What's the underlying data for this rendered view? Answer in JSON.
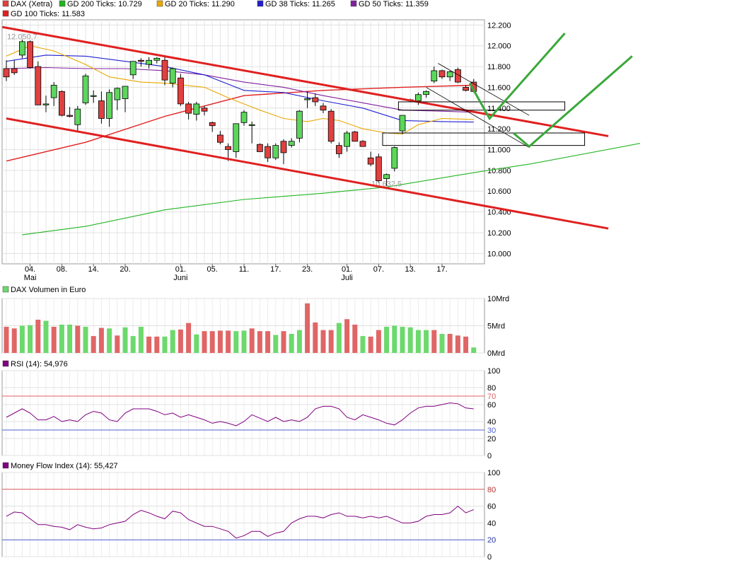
{
  "chart_data": [
    {
      "type": "candlestick",
      "title": "DAX (Xetra)",
      "legend": [
        {
          "label": "DAX (Xetra)",
          "color": "#e04040"
        },
        {
          "label": "GD 200 Ticks: 10.729",
          "color": "#22b422"
        },
        {
          "label": "GD 20 Ticks: 11.290",
          "color": "#e8a800"
        },
        {
          "label": "GD 38 Ticks: 11.265",
          "color": "#2020d0"
        },
        {
          "label": "GD 50 Ticks: 11.359",
          "color": "#8020a0"
        },
        {
          "label": "GD 100 Ticks: 11.583",
          "color": "#e02020"
        }
      ],
      "ylim": [
        9900,
        12250
      ],
      "yticks": [
        10000,
        10200,
        10400,
        10600,
        10800,
        11000,
        11200,
        11400,
        11600,
        11800,
        12000,
        12200
      ],
      "ytick_labels": [
        "10.000",
        "10.200",
        "10.400",
        "10.600",
        "10.800",
        "11.000",
        "11.200",
        "11.400",
        "11.600",
        "11.800",
        "12.000",
        "12.200"
      ],
      "xtick_labels": [
        {
          "i": 3,
          "day": "04.",
          "month": "Mai"
        },
        {
          "i": 7,
          "day": "08.",
          "month": ""
        },
        {
          "i": 11,
          "day": "14.",
          "month": ""
        },
        {
          "i": 15,
          "day": "20.",
          "month": ""
        },
        {
          "i": 22,
          "day": "01.",
          "month": "Juni"
        },
        {
          "i": 26,
          "day": "05.",
          "month": ""
        },
        {
          "i": 30,
          "day": "11.",
          "month": ""
        },
        {
          "i": 34,
          "day": "17.",
          "month": ""
        },
        {
          "i": 38,
          "day": "23.",
          "month": ""
        },
        {
          "i": 43,
          "day": "01.",
          "month": "Juli"
        },
        {
          "i": 47,
          "day": "07.",
          "month": ""
        },
        {
          "i": 51,
          "day": "13.",
          "month": ""
        },
        {
          "i": 55,
          "day": "17.",
          "month": ""
        }
      ],
      "annotations": [
        {
          "text": "12.050,7",
          "i": 2,
          "value": 12050
        },
        {
          "text": "10.632,5",
          "i": 48,
          "value": 10632
        }
      ],
      "candles": [
        [
          11780,
          11860,
          11660,
          11700
        ],
        [
          11780,
          11860,
          11720,
          11740
        ],
        [
          11910,
          12060,
          11880,
          12040
        ],
        [
          12040,
          12050,
          11780,
          11790
        ],
        [
          11800,
          11850,
          11430,
          11430
        ],
        [
          11430,
          11520,
          11360,
          11440
        ],
        [
          11500,
          11650,
          11420,
          11620
        ],
        [
          11560,
          11570,
          11320,
          11330
        ],
        [
          11330,
          11410,
          11310,
          11320
        ],
        [
          11240,
          11420,
          11180,
          11390
        ],
        [
          11450,
          11730,
          11430,
          11710
        ],
        [
          11520,
          11570,
          11450,
          11520
        ],
        [
          11470,
          11560,
          11250,
          11300
        ],
        [
          11300,
          11580,
          11220,
          11550
        ],
        [
          11480,
          11600,
          11380,
          11590
        ],
        [
          11490,
          11600,
          11360,
          11610
        ],
        [
          11720,
          11850,
          11680,
          11850
        ],
        [
          11860,
          11880,
          11800,
          11850
        ],
        [
          11820,
          11890,
          11780,
          11860
        ],
        [
          11860,
          11890,
          11830,
          11880
        ],
        [
          11860,
          11890,
          11620,
          11670
        ],
        [
          11640,
          11790,
          11600,
          11780
        ],
        [
          11690,
          11730,
          11420,
          11440
        ],
        [
          11440,
          11460,
          11290,
          11350
        ],
        [
          11340,
          11460,
          11280,
          11440
        ],
        [
          11400,
          11420,
          11330,
          11370
        ],
        [
          11260,
          11270,
          11170,
          11230
        ],
        [
          11140,
          11180,
          11050,
          11070
        ],
        [
          11030,
          11060,
          10890,
          11000
        ],
        [
          10980,
          11230,
          10920,
          11250
        ],
        [
          11260,
          11380,
          11230,
          11360
        ],
        [
          11240,
          11270,
          11060,
          11240
        ],
        [
          11050,
          11060,
          10980,
          10980
        ],
        [
          11030,
          11060,
          10880,
          10920
        ],
        [
          10920,
          11060,
          10900,
          11040
        ],
        [
          11080,
          11100,
          10860,
          10970
        ],
        [
          11040,
          11110,
          11020,
          11080
        ],
        [
          11110,
          11380,
          11070,
          11370
        ],
        [
          11480,
          11560,
          11400,
          11490
        ],
        [
          11500,
          11540,
          11420,
          11460
        ],
        [
          11420,
          11450,
          11350,
          11380
        ],
        [
          11370,
          11390,
          11060,
          11080
        ],
        [
          11040,
          11070,
          10920,
          10960
        ],
        [
          11030,
          11180,
          10980,
          11160
        ],
        [
          11170,
          11180,
          11080,
          11080
        ],
        [
          11080,
          11090,
          11030,
          11030
        ],
        [
          10920,
          10980,
          10840,
          10860
        ],
        [
          10930,
          10960,
          10680,
          10700
        ],
        [
          10720,
          10770,
          10650,
          10760
        ],
        [
          10820,
          11030,
          10790,
          11020
        ],
        [
          11180,
          11320,
          11150,
          11330
        ],
        [
          11480,
          11490,
          11460,
          11480
        ],
        [
          11470,
          11550,
          11430,
          11530
        ],
        [
          11530,
          11570,
          11500,
          11560
        ],
        [
          11660,
          11800,
          11640,
          11760
        ],
        [
          11760,
          11770,
          11680,
          11700
        ],
        [
          11700,
          11760,
          11660,
          11750
        ],
        [
          11770,
          11790,
          11640,
          11650
        ],
        [
          11600,
          11620,
          11560,
          11570
        ],
        [
          11650,
          11680,
          11550,
          11560
        ]
      ],
      "ma_series": [
        {
          "name": "GD 200 Ticks: 10.729",
          "color": "#22b422",
          "points": [
            [
              2,
              10180
            ],
            [
              10,
              10260
            ],
            [
              20,
              10420
            ],
            [
              30,
              10520
            ],
            [
              40,
              10580
            ],
            [
              48,
              10640
            ],
            [
              60,
              10790
            ],
            [
              66,
              10860
            ],
            [
              80,
              11060
            ]
          ]
        },
        {
          "name": "GD 100 Ticks: 11.583",
          "color": "#e02020",
          "points": [
            [
              0,
              10890
            ],
            [
              10,
              11070
            ],
            [
              20,
              11320
            ],
            [
              30,
              11520
            ],
            [
              40,
              11570
            ],
            [
              50,
              11600
            ],
            [
              59,
              11620
            ]
          ]
        },
        {
          "name": "GD 50 Ticks: 11.359",
          "color": "#8020a0",
          "points": [
            [
              0,
              11780
            ],
            [
              5,
              11790
            ],
            [
              10,
              11780
            ],
            [
              15,
              11780
            ],
            [
              20,
              11760
            ],
            [
              25,
              11720
            ],
            [
              30,
              11650
            ],
            [
              35,
              11600
            ],
            [
              40,
              11520
            ],
            [
              45,
              11450
            ],
            [
              50,
              11380
            ],
            [
              55,
              11370
            ],
            [
              59,
              11360
            ]
          ]
        },
        {
          "name": "GD 38 Ticks: 11.265",
          "color": "#2020d0",
          "points": [
            [
              0,
              11850
            ],
            [
              5,
              11910
            ],
            [
              10,
              11900
            ],
            [
              15,
              11850
            ],
            [
              20,
              11800
            ],
            [
              25,
              11720
            ],
            [
              30,
              11570
            ],
            [
              35,
              11550
            ],
            [
              40,
              11470
            ],
            [
              45,
              11400
            ],
            [
              50,
              11280
            ],
            [
              55,
              11270
            ],
            [
              59,
              11265
            ]
          ]
        },
        {
          "name": "GD 20 Ticks: 11.290",
          "color": "#e8a800",
          "points": [
            [
              0,
              11900
            ],
            [
              3,
              12000
            ],
            [
              6,
              11950
            ],
            [
              10,
              11820
            ],
            [
              13,
              11700
            ],
            [
              17,
              11650
            ],
            [
              20,
              11640
            ],
            [
              25,
              11600
            ],
            [
              28,
              11500
            ],
            [
              32,
              11380
            ],
            [
              35,
              11300
            ],
            [
              38,
              11270
            ],
            [
              40,
              11300
            ],
            [
              42,
              11280
            ],
            [
              45,
              11200
            ],
            [
              48,
              11160
            ],
            [
              50,
              11150
            ],
            [
              52,
              11240
            ],
            [
              55,
              11300
            ],
            [
              59,
              11290
            ]
          ]
        }
      ],
      "drawings": {
        "red_trendlines": [
          [
            [
              -0.5,
              12180
            ],
            [
              76,
              11130
            ]
          ],
          [
            [
              0,
              11300
            ],
            [
              76,
              10240
            ]
          ]
        ],
        "black_channel": [
          [
            [
              54.5,
              11830
            ],
            [
              66,
              11330
            ]
          ],
          [
            [
              53,
              11600
            ],
            [
              66,
              11020
            ]
          ]
        ],
        "rectangles": [
          {
            "x0": 49.5,
            "x1": 70.5,
            "y0": 11380,
            "y1": 11460
          },
          {
            "x0": 47.5,
            "x1": 73,
            "y0": 11040,
            "y1": 11160
          }
        ],
        "green_arrows": [
          [
            [
              58.5,
              11640
            ],
            [
              61,
              11300
            ],
            [
              70.5,
              12120
            ]
          ],
          [
            [
              64,
              11160
            ],
            [
              66,
              11030
            ],
            [
              79,
              11900
            ]
          ]
        ]
      }
    },
    {
      "type": "bar",
      "title": "DAX Volumen in Euro",
      "ylim": [
        0,
        10
      ],
      "yticks": [
        0,
        5,
        10
      ],
      "ytick_labels": [
        "0Mrd",
        "5Mrd",
        "10Mrd"
      ],
      "values": [
        4.8,
        4.5,
        5.0,
        5.1,
        6.1,
        5.9,
        4.8,
        5.2,
        5.2,
        5.0,
        4.8,
        3.1,
        4.6,
        4.5,
        3.2,
        4.7,
        3.1,
        4.8,
        3.0,
        3.0,
        3.0,
        4.2,
        4.3,
        5.5,
        3.4,
        4.0,
        4.0,
        4.1,
        4.1,
        4.0,
        4.1,
        4.5,
        4.0,
        4.0,
        3.3,
        4.0,
        3.5,
        4.2,
        9.1,
        5.6,
        4.2,
        4.2,
        5.5,
        6.2,
        5.2,
        3.1,
        3.0,
        4.2,
        4.8,
        5.0,
        4.8,
        4.7,
        4.2,
        4.2,
        4.2,
        3.5,
        3.5,
        3.2,
        3.0,
        1.0
      ],
      "colors": [
        "r",
        "r",
        "g",
        "g",
        "r",
        "g",
        "r",
        "g",
        "g",
        "r",
        "g",
        "r",
        "r",
        "g",
        "r",
        "g",
        "g",
        "g",
        "r",
        "r",
        "g",
        "g",
        "r",
        "r",
        "g",
        "r",
        "r",
        "r",
        "r",
        "g",
        "g",
        "r",
        "r",
        "r",
        "g",
        "r",
        "g",
        "g",
        "r",
        "r",
        "r",
        "r",
        "g",
        "r",
        "r",
        "g",
        "r",
        "r",
        "g",
        "g",
        "g",
        "g",
        "g",
        "g",
        "r",
        "g",
        "r",
        "r",
        "r",
        "g"
      ]
    },
    {
      "type": "line",
      "title": "RSI (14): 54,976",
      "ylim": [
        0,
        100
      ],
      "yticks": [
        0,
        20,
        40,
        60,
        80,
        100
      ],
      "ytick_labels": [
        "0",
        "20",
        "40",
        "60",
        "80",
        "100"
      ],
      "ref_lines": [
        {
          "value": 70,
          "label": "70",
          "color": "#e06060"
        },
        {
          "value": 30,
          "label": "30",
          "color": "#5060d0"
        }
      ],
      "color": "#800080",
      "values": [
        45,
        50,
        55,
        50,
        42,
        42,
        46,
        40,
        42,
        40,
        48,
        52,
        50,
        42,
        40,
        50,
        55,
        55,
        55,
        52,
        48,
        50,
        45,
        48,
        45,
        42,
        38,
        40,
        38,
        35,
        40,
        48,
        44,
        40,
        45,
        40,
        42,
        40,
        45,
        55,
        58,
        58,
        55,
        45,
        42,
        48,
        45,
        42,
        38,
        36,
        42,
        50,
        56,
        58,
        58,
        60,
        62,
        61,
        56,
        55
      ]
    },
    {
      "type": "line",
      "title": "Money Flow Index (14): 55,427",
      "ylim": [
        0,
        100
      ],
      "yticks": [
        0,
        20,
        40,
        60,
        80,
        100
      ],
      "ytick_labels": [
        "0",
        "20",
        "40",
        "60",
        "80",
        "100"
      ],
      "ref_lines": [
        {
          "value": 80,
          "label": "80",
          "color": "#e06060"
        },
        {
          "value": 20,
          "label": "20",
          "color": "#5060d0"
        }
      ],
      "color": "#800080",
      "values": [
        48,
        53,
        52,
        45,
        38,
        38,
        36,
        35,
        32,
        38,
        35,
        33,
        34,
        38,
        40,
        42,
        50,
        55,
        52,
        48,
        45,
        54,
        52,
        44,
        40,
        36,
        36,
        33,
        30,
        22,
        25,
        30,
        30,
        24,
        28,
        30,
        40,
        45,
        48,
        48,
        46,
        50,
        52,
        48,
        48,
        46,
        48,
        46,
        48,
        44,
        40,
        40,
        42,
        48,
        50,
        50,
        52,
        60,
        52,
        56
      ]
    }
  ]
}
